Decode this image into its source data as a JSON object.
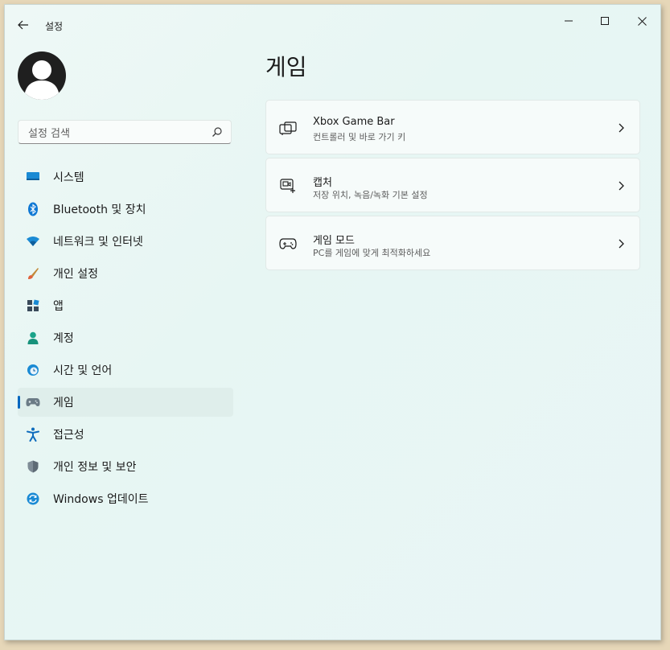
{
  "window": {
    "title": "설정"
  },
  "search": {
    "placeholder": "설정 검색"
  },
  "sidebar": {
    "items": [
      {
        "label": "시스템",
        "icon": "monitor-icon",
        "active": false
      },
      {
        "label": "Bluetooth 및 장치",
        "icon": "bluetooth-icon",
        "active": false
      },
      {
        "label": "네트워크 및 인터넷",
        "icon": "wifi-icon",
        "active": false
      },
      {
        "label": "개인 설정",
        "icon": "brush-icon",
        "active": false
      },
      {
        "label": "앱",
        "icon": "apps-icon",
        "active": false
      },
      {
        "label": "계정",
        "icon": "person-icon",
        "active": false
      },
      {
        "label": "시간 및 언어",
        "icon": "clock-globe-icon",
        "active": false
      },
      {
        "label": "게임",
        "icon": "gamepad-icon",
        "active": true
      },
      {
        "label": "접근성",
        "icon": "accessibility-icon",
        "active": false
      },
      {
        "label": "개인 정보 및 보안",
        "icon": "shield-icon",
        "active": false
      },
      {
        "label": "Windows 업데이트",
        "icon": "update-icon",
        "active": false
      }
    ]
  },
  "main": {
    "title": "게임",
    "cards": [
      {
        "title": "Xbox Game Bar",
        "subtitle": "컨트롤러 및 바로 가기 키",
        "icon": "game-bar-icon"
      },
      {
        "title": "캡처",
        "subtitle": "저장 위치, 녹음/녹화 기본 설정",
        "icon": "capture-icon"
      },
      {
        "title": "게임 모드",
        "subtitle": "PC를 게임에 맞게 최적화하세요",
        "icon": "game-mode-icon"
      }
    ]
  },
  "colors": {
    "accent": "#0067c0",
    "window_bg": "#e7f6f3",
    "active_item_bg": "#dfeeeb"
  }
}
